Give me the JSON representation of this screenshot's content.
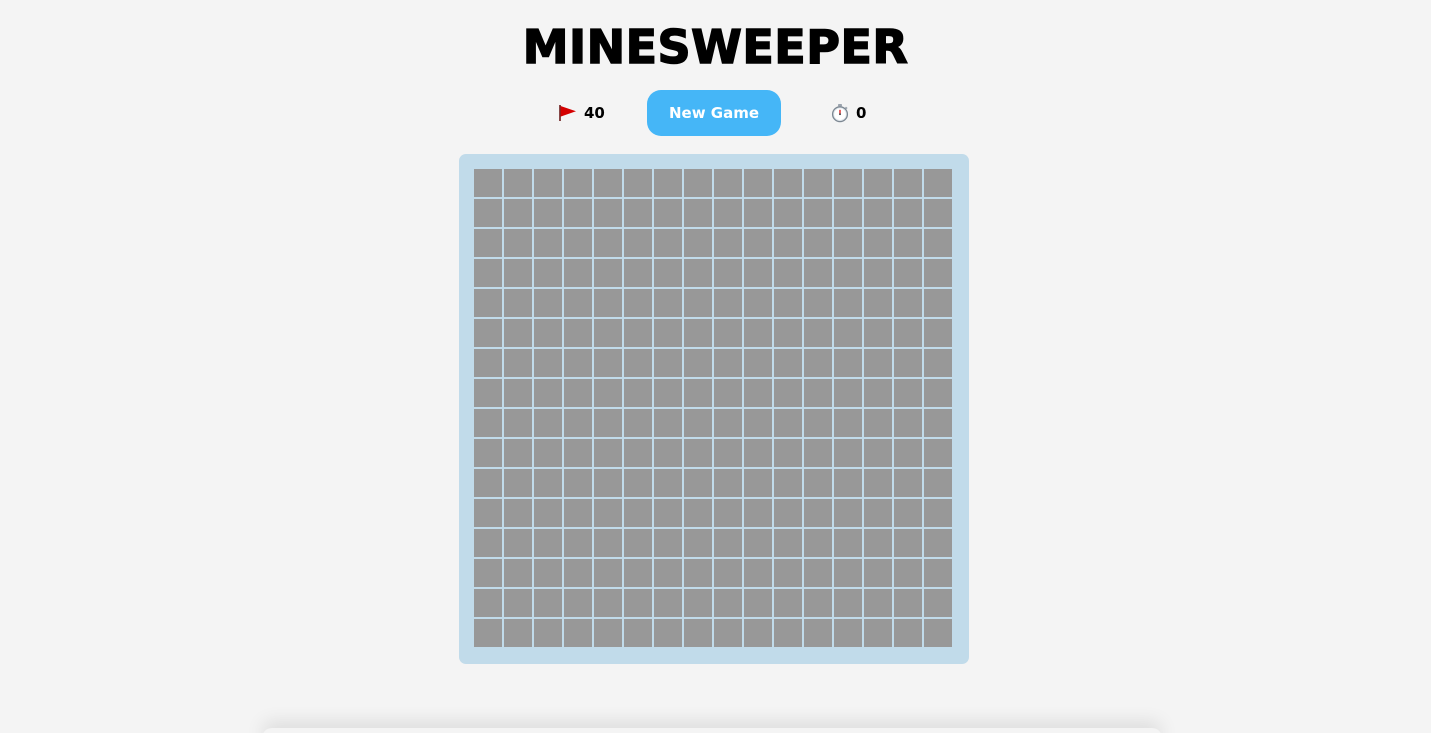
{
  "title": "MINESWEEPER",
  "toolbar": {
    "flags": {
      "icon": "red-flag-icon",
      "value": "40"
    },
    "new_game_label": "New Game",
    "timer": {
      "icon": "stopwatch-icon",
      "value": "0"
    }
  },
  "board": {
    "rows": 16,
    "cols": 16,
    "cell_state": "hidden"
  },
  "colors": {
    "background": "#f4f4f4",
    "button": "#45b6f7",
    "board_frame": "#c1dbea",
    "hidden_cell": "#989898",
    "flag": "#d40000"
  }
}
